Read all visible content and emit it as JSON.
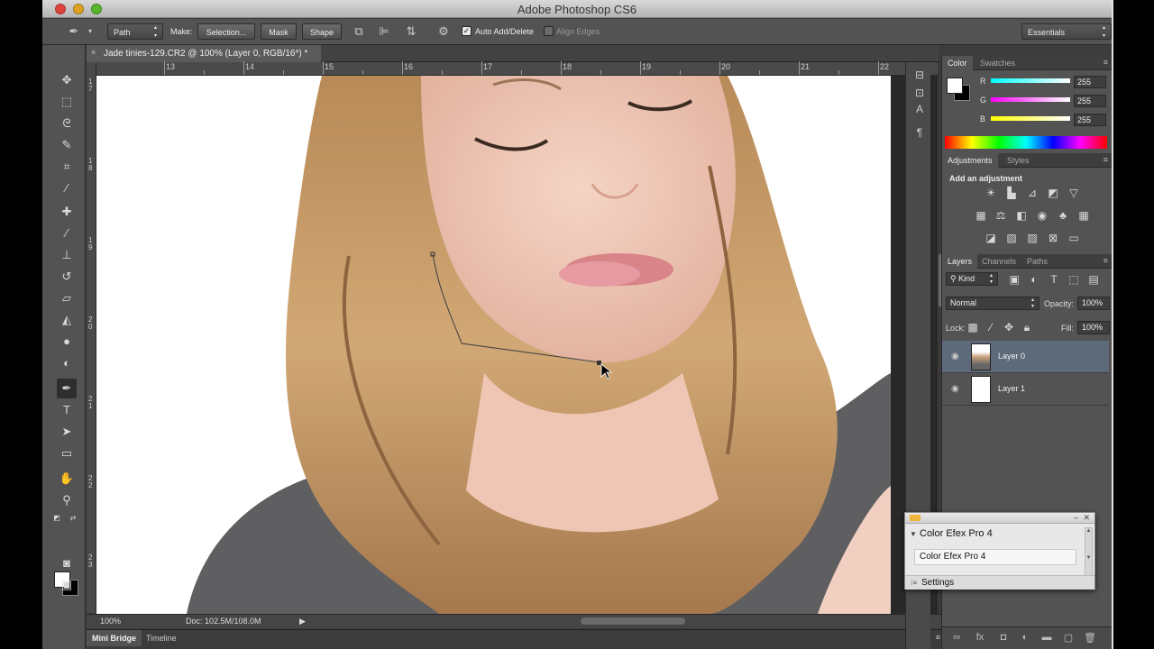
{
  "app": {
    "title": "Adobe Photoshop CS6"
  },
  "options_bar": {
    "tool_mode": "Path",
    "make_label": "Make:",
    "selection_button": "Selection...",
    "mask_button": "Mask",
    "shape_button": "Shape",
    "auto_add_delete_label": "Auto Add/Delete",
    "auto_add_delete_checked": true,
    "align_edges_label": "Align Edges",
    "align_edges_checked": false,
    "workspace": "Essentials"
  },
  "document": {
    "tab_title": "Jade tinies-129.CR2 @ 100% (Layer 0, RGB/16*) *",
    "close_glyph": "×",
    "ruler_h": [
      "13",
      "14",
      "15",
      "16",
      "17",
      "18",
      "19",
      "20",
      "21",
      "22"
    ],
    "ruler_v": [
      "7",
      "8",
      "9",
      "0",
      "1",
      "2",
      "3"
    ],
    "ruler_v_prefix": [
      "1",
      "1",
      "1",
      "2",
      "2",
      "2",
      "2"
    ]
  },
  "status": {
    "zoom": "100%",
    "doc_size": "Doc: 102.5M/108.0M",
    "arrow": "▶"
  },
  "bottom_tabs": {
    "mini_bridge": "Mini Bridge",
    "timeline": "Timeline"
  },
  "color_panel": {
    "tab_color": "Color",
    "tab_swatches": "Swatches",
    "r_label": "R",
    "g_label": "G",
    "b_label": "B",
    "r_value": "255",
    "g_value": "255",
    "b_value": "255"
  },
  "adjustments_panel": {
    "tab_adjustments": "Adjustments",
    "tab_styles": "Styles",
    "add_label": "Add an adjustment"
  },
  "layers_panel": {
    "tab_layers": "Layers",
    "tab_channels": "Channels",
    "tab_paths": "Paths",
    "kind": "Kind",
    "blend_mode": "Normal",
    "opacity_label": "Opacity:",
    "opacity_value": "100%",
    "lock_label": "Lock:",
    "fill_label": "Fill:",
    "fill_value": "100%",
    "layers": [
      {
        "name": "Layer 0",
        "selected": true
      },
      {
        "name": "Layer 1",
        "selected": false
      }
    ]
  },
  "efex_panel": {
    "title": "Color Efex Pro 4",
    "item": "Color Efex Pro 4",
    "settings": "Settings"
  },
  "colors": {
    "accent_selected_layer": "#5d6a7a",
    "ui_dark": "#535353"
  }
}
